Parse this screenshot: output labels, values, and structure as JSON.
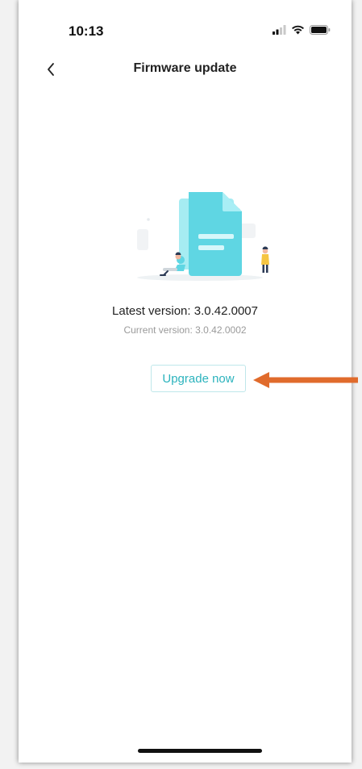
{
  "status_bar": {
    "time": "10:13",
    "icons": [
      "signal-icon",
      "wifi-icon",
      "battery-icon"
    ]
  },
  "nav": {
    "back_icon": "chevron-left-icon",
    "title": "Firmware update"
  },
  "content": {
    "illustration": "document-update-illustration",
    "latest_version": "Latest version: 3.0.42.0007",
    "current_version": "Current version: 3.0.42.0002",
    "upgrade_label": "Upgrade now"
  },
  "annotation": {
    "icon": "arrow-left-icon",
    "color": "#E06B2C"
  },
  "colors": {
    "accent": "#2BB3BD",
    "illustration_primary": "#5FD6E3",
    "illustration_light": "#A6ECF2"
  }
}
